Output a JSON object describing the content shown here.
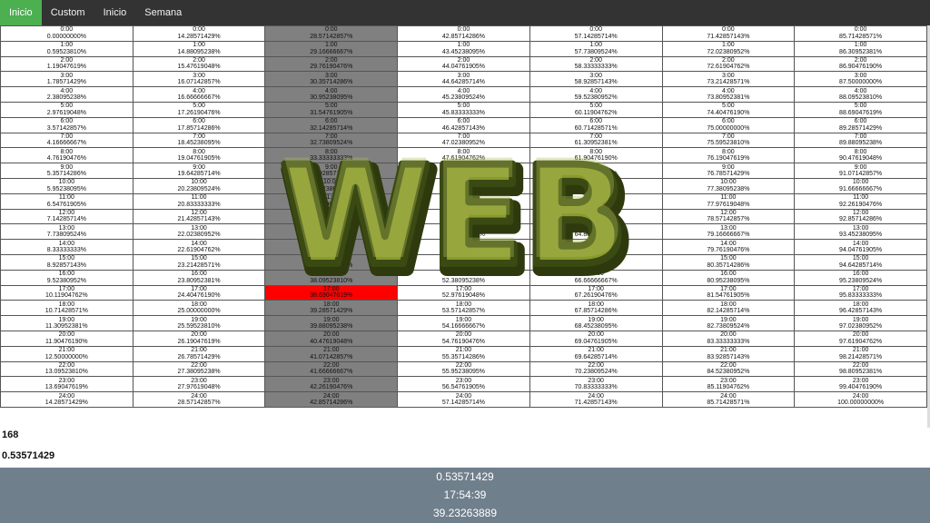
{
  "nav": {
    "items": [
      {
        "label": "Inicio",
        "active": true
      },
      {
        "label": "Custom",
        "active": false
      },
      {
        "label": "Inicio",
        "active": false
      },
      {
        "label": "Semana",
        "active": false
      }
    ]
  },
  "grid": {
    "highlight_column": 2,
    "highlight_cell": {
      "row": 17,
      "col": 2
    },
    "rows": [
      [
        [
          "0:00",
          "0.00000000%"
        ],
        [
          "0:00",
          "14.28571429%"
        ],
        [
          "0:00",
          "28.57142857%"
        ],
        [
          "0:00",
          "42.85714286%"
        ],
        [
          "0:00",
          "57.14285714%"
        ],
        [
          "0:00",
          "71.42857143%"
        ],
        [
          "0:00",
          "85.71428571%"
        ]
      ],
      [
        [
          "1:00",
          "0.59523810%"
        ],
        [
          "1:00",
          "14.88095238%"
        ],
        [
          "1:00",
          "29.16666667%"
        ],
        [
          "1:00",
          "43.45238095%"
        ],
        [
          "1:00",
          "57.73809524%"
        ],
        [
          "1:00",
          "72.02380952%"
        ],
        [
          "1:00",
          "86.30952381%"
        ]
      ],
      [
        [
          "2:00",
          "1.19047619%"
        ],
        [
          "2:00",
          "15.47619048%"
        ],
        [
          "2:00",
          "29.76190476%"
        ],
        [
          "2:00",
          "44.04761905%"
        ],
        [
          "2:00",
          "58.33333333%"
        ],
        [
          "2:00",
          "72.61904762%"
        ],
        [
          "2:00",
          "86.90476190%"
        ]
      ],
      [
        [
          "3:00",
          "1.78571429%"
        ],
        [
          "3:00",
          "16.07142857%"
        ],
        [
          "3:00",
          "30.35714286%"
        ],
        [
          "3:00",
          "44.64285714%"
        ],
        [
          "3:00",
          "58.92857143%"
        ],
        [
          "3:00",
          "73.21428571%"
        ],
        [
          "3:00",
          "87.50000000%"
        ]
      ],
      [
        [
          "4:00",
          "2.38095238%"
        ],
        [
          "4:00",
          "16.66666667%"
        ],
        [
          "4:00",
          "30.95238095%"
        ],
        [
          "4:00",
          "45.23809524%"
        ],
        [
          "4:00",
          "59.52380952%"
        ],
        [
          "4:00",
          "73.80952381%"
        ],
        [
          "4:00",
          "88.09523810%"
        ]
      ],
      [
        [
          "5:00",
          "2.97619048%"
        ],
        [
          "5:00",
          "17.26190476%"
        ],
        [
          "5:00",
          "31.54761905%"
        ],
        [
          "5:00",
          "45.83333333%"
        ],
        [
          "5:00",
          "60.11904762%"
        ],
        [
          "5:00",
          "74.40476190%"
        ],
        [
          "5:00",
          "88.69047619%"
        ]
      ],
      [
        [
          "6:00",
          "3.57142857%"
        ],
        [
          "6:00",
          "17.85714286%"
        ],
        [
          "6:00",
          "32.14285714%"
        ],
        [
          "6:00",
          "46.42857143%"
        ],
        [
          "6:00",
          "60.71428571%"
        ],
        [
          "6:00",
          "75.00000000%"
        ],
        [
          "6:00",
          "89.28571429%"
        ]
      ],
      [
        [
          "7:00",
          "4.16666667%"
        ],
        [
          "7:00",
          "18.45238095%"
        ],
        [
          "7:00",
          "32.73809524%"
        ],
        [
          "7:00",
          "47.02380952%"
        ],
        [
          "7:00",
          "61.30952381%"
        ],
        [
          "7:00",
          "75.59523810%"
        ],
        [
          "7:00",
          "89.88095238%"
        ]
      ],
      [
        [
          "8:00",
          "4.76190476%"
        ],
        [
          "8:00",
          "19.04761905%"
        ],
        [
          "8:00",
          "33.33333333%"
        ],
        [
          "8:00",
          "47.61904762%"
        ],
        [
          "8:00",
          "61.90476190%"
        ],
        [
          "8:00",
          "76.19047619%"
        ],
        [
          "8:00",
          "90.47619048%"
        ]
      ],
      [
        [
          "9:00",
          "5.35714286%"
        ],
        [
          "9:00",
          "19.64285714%"
        ],
        [
          "9:00",
          "33.92857143%"
        ],
        [
          "9:00",
          "48.21428571%"
        ],
        [
          "9:00",
          "62.50000000%"
        ],
        [
          "9:00",
          "76.78571429%"
        ],
        [
          "9:00",
          "91.07142857%"
        ]
      ],
      [
        [
          "10:00",
          "5.95238095%"
        ],
        [
          "10:00",
          "20.23809524%"
        ],
        [
          "10:00",
          "34.52380952%"
        ],
        [
          "10:00",
          "48.80952381%"
        ],
        [
          "10:00",
          "63.09523810%"
        ],
        [
          "10:00",
          "77.38095238%"
        ],
        [
          "10:00",
          "91.66666667%"
        ]
      ],
      [
        [
          "11:00",
          "6.54761905%"
        ],
        [
          "11:00",
          "20.83333333%"
        ],
        [
          "11:00",
          "35.11904762%"
        ],
        [
          "11:00",
          "49.40476190%"
        ],
        [
          "11:00",
          "63.69047619%"
        ],
        [
          "11:00",
          "77.97619048%"
        ],
        [
          "11:00",
          "92.26190476%"
        ]
      ],
      [
        [
          "12:00",
          "7.14285714%"
        ],
        [
          "12:00",
          "21.42857143%"
        ],
        [
          "12:00",
          "35.71428571%"
        ],
        [
          "12:00",
          "50.00000000%"
        ],
        [
          "12:00",
          "64.28571429%"
        ],
        [
          "12:00",
          "78.57142857%"
        ],
        [
          "12:00",
          "92.85714286%"
        ]
      ],
      [
        [
          "13:00",
          "7.73809524%"
        ],
        [
          "13:00",
          "22.02380952%"
        ],
        [
          "13:00",
          "36.30952381%"
        ],
        [
          "13:00",
          "50.59523810%"
        ],
        [
          "13:00",
          "64.88095238%"
        ],
        [
          "13:00",
          "79.16666667%"
        ],
        [
          "13:00",
          "93.45238095%"
        ]
      ],
      [
        [
          "14:00",
          "8.33333333%"
        ],
        [
          "14:00",
          "22.61904762%"
        ],
        [
          "14:00",
          "36.90476190%"
        ],
        [
          "14:00",
          "51.19047619%"
        ],
        [
          "14:00",
          "65.47619048%"
        ],
        [
          "14:00",
          "79.76190476%"
        ],
        [
          "14:00",
          "94.04761905%"
        ]
      ],
      [
        [
          "15:00",
          "8.92857143%"
        ],
        [
          "15:00",
          "23.21428571%"
        ],
        [
          "15:00",
          "37.50000000%"
        ],
        [
          "15:00",
          "51.78571429%"
        ],
        [
          "15:00",
          "66.07142857%"
        ],
        [
          "15:00",
          "80.35714286%"
        ],
        [
          "15:00",
          "94.64285714%"
        ]
      ],
      [
        [
          "16:00",
          "9.52380952%"
        ],
        [
          "16:00",
          "23.80952381%"
        ],
        [
          "16:00",
          "38.09523810%"
        ],
        [
          "16:00",
          "52.38095238%"
        ],
        [
          "16:00",
          "66.66666667%"
        ],
        [
          "16:00",
          "80.95238095%"
        ],
        [
          "16:00",
          "95.23809524%"
        ]
      ],
      [
        [
          "17:00",
          "10.11904762%"
        ],
        [
          "17:00",
          "24.40476190%"
        ],
        [
          "17:00",
          "38.69047619%"
        ],
        [
          "17:00",
          "52.97619048%"
        ],
        [
          "17:00",
          "67.26190476%"
        ],
        [
          "17:00",
          "81.54761905%"
        ],
        [
          "17:00",
          "95.83333333%"
        ]
      ],
      [
        [
          "18:00",
          "10.71428571%"
        ],
        [
          "18:00",
          "25.00000000%"
        ],
        [
          "18:00",
          "39.28571429%"
        ],
        [
          "18:00",
          "53.57142857%"
        ],
        [
          "18:00",
          "67.85714286%"
        ],
        [
          "18:00",
          "82.14285714%"
        ],
        [
          "18:00",
          "96.42857143%"
        ]
      ],
      [
        [
          "19:00",
          "11.30952381%"
        ],
        [
          "19:00",
          "25.59523810%"
        ],
        [
          "19:00",
          "39.88095238%"
        ],
        [
          "19:00",
          "54.16666667%"
        ],
        [
          "19:00",
          "68.45238095%"
        ],
        [
          "19:00",
          "82.73809524%"
        ],
        [
          "19:00",
          "97.02380952%"
        ]
      ],
      [
        [
          "20:00",
          "11.90476190%"
        ],
        [
          "20:00",
          "26.19047619%"
        ],
        [
          "20:00",
          "40.47619048%"
        ],
        [
          "20:00",
          "54.76190476%"
        ],
        [
          "20:00",
          "69.04761905%"
        ],
        [
          "20:00",
          "83.33333333%"
        ],
        [
          "20:00",
          "97.61904762%"
        ]
      ],
      [
        [
          "21:00",
          "12.50000000%"
        ],
        [
          "21:00",
          "26.78571429%"
        ],
        [
          "21:00",
          "41.07142857%"
        ],
        [
          "21:00",
          "55.35714286%"
        ],
        [
          "21:00",
          "69.64285714%"
        ],
        [
          "21:00",
          "83.92857143%"
        ],
        [
          "21:00",
          "98.21428571%"
        ]
      ],
      [
        [
          "22:00",
          "13.09523810%"
        ],
        [
          "22:00",
          "27.38095238%"
        ],
        [
          "22:00",
          "41.66666667%"
        ],
        [
          "22:00",
          "55.95238095%"
        ],
        [
          "22:00",
          "70.23809524%"
        ],
        [
          "22:00",
          "84.52380952%"
        ],
        [
          "22:00",
          "98.80952381%"
        ]
      ],
      [
        [
          "23:00",
          "13.69047619%"
        ],
        [
          "23:00",
          "27.97619048%"
        ],
        [
          "23:00",
          "42.26190476%"
        ],
        [
          "23:00",
          "56.54761905%"
        ],
        [
          "23:00",
          "70.83333333%"
        ],
        [
          "23:00",
          "85.11904762%"
        ],
        [
          "23:00",
          "99.40476190%"
        ]
      ],
      [
        [
          "24:00",
          "14.28571429%"
        ],
        [
          "24:00",
          "28.57142857%"
        ],
        [
          "24:00",
          "42.85714286%"
        ],
        [
          "24:00",
          "57.14285714%"
        ],
        [
          "24:00",
          "71.42857143%"
        ],
        [
          "24:00",
          "85.71428571%"
        ],
        [
          "24:00",
          "100.00000000%"
        ]
      ]
    ]
  },
  "output": {
    "count": "168",
    "value": "0.53571429"
  },
  "footer": {
    "line1": "0.53571429",
    "line2": "17:54:39",
    "line3": "39.23263889"
  },
  "logo": {
    "text": "WEB"
  },
  "colors": {
    "nav_bg": "#333333",
    "nav_active": "#4CAF50",
    "highlight_col": "#808080",
    "highlight_cell": "#ff0000",
    "footer_bg": "#707f8c",
    "logo_fill": "#8a9a2e",
    "logo_outline": "#3a4a12"
  }
}
